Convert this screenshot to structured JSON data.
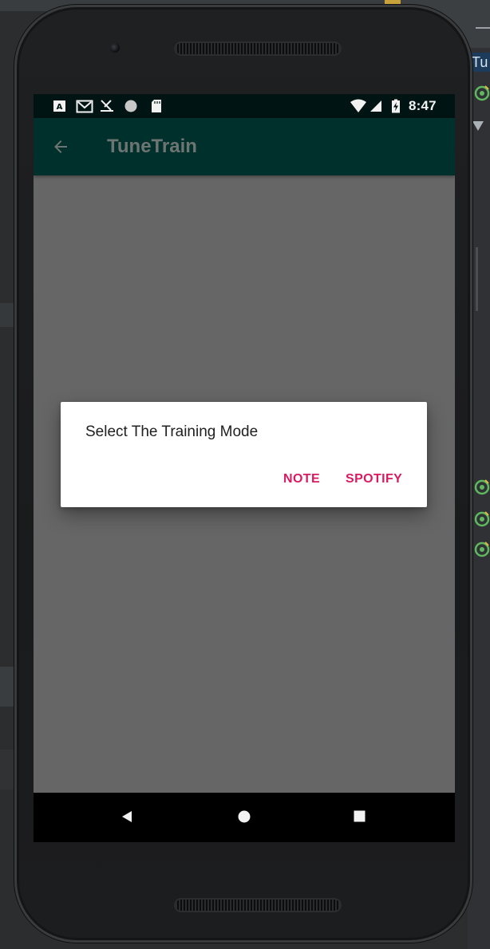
{
  "status_bar": {
    "time": "8:47",
    "icons": [
      "a-notification-icon",
      "gmail-icon",
      "scissors-icon",
      "circle-notification-icon",
      "sd-card-icon",
      "wifi-icon",
      "signal-icon",
      "battery-charging-icon"
    ]
  },
  "app_bar": {
    "title": "TuneTrain",
    "back_icon": "arrow-back-icon"
  },
  "dialog": {
    "title": "Select The Training Mode",
    "buttons": [
      {
        "label": "NOTE"
      },
      {
        "label": "SPOTIFY"
      }
    ],
    "accent_color": "#d81b60"
  },
  "nav_bar": {
    "icons": [
      "nav-back-icon",
      "nav-home-icon",
      "nav-recent-icon"
    ]
  },
  "ide": {
    "tab_text": "Tu"
  },
  "colors": {
    "status_bar": "#001413",
    "app_bar": "#00302b",
    "scrim": "#666666",
    "nav_bar": "#000000"
  }
}
